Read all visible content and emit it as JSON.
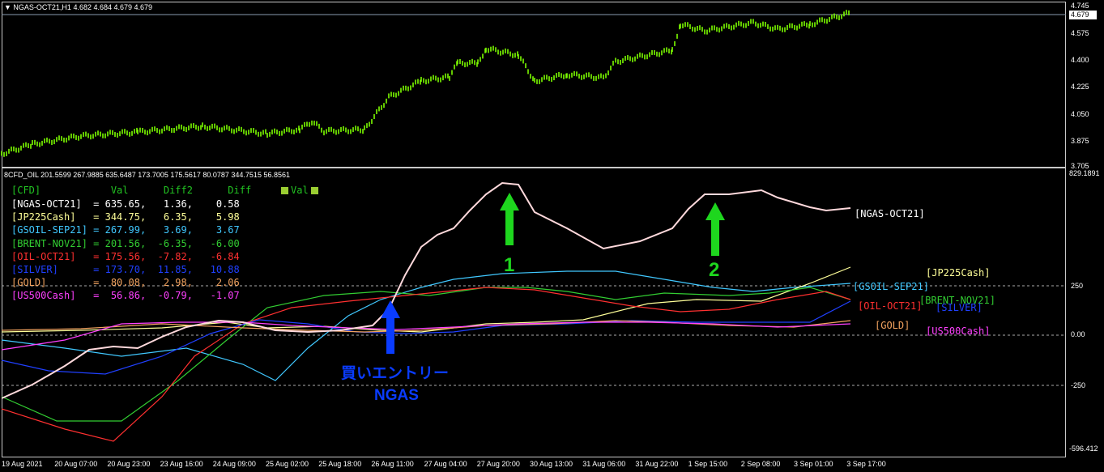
{
  "chart_title": "NGAS-OCT21,H1  4.682 4.684 4.679 4.679",
  "indicator_title": "8CFD_OIL 201.5599 267.9885 635.6487 173.7005 175.5617 80.0787 344.7515 56.8561",
  "current_price_tag": "4.679",
  "price_axis": [
    "4.745",
    "4.575",
    "4.400",
    "4.225",
    "4.050",
    "3.875",
    "3.705"
  ],
  "indicator_axis": [
    "829.1891",
    "250",
    "0.00",
    "-250",
    "-596.412"
  ],
  "time_axis": [
    "19 Aug 2021",
    "20 Aug 07:00",
    "20 Aug 23:00",
    "23 Aug 16:00",
    "24 Aug 09:00",
    "25 Aug 02:00",
    "25 Aug 18:00",
    "26 Aug 11:00",
    "27 Aug 04:00",
    "27 Aug 20:00",
    "30 Aug 13:00",
    "31 Aug 06:00",
    "31 Aug 22:00",
    "1 Sep 15:00",
    "2 Sep 08:00",
    "3 Sep 01:00",
    "3 Sep 17:00"
  ],
  "table": {
    "header": "[CFD]            Val      Diff2      Diff",
    "legend_label": "Val",
    "rows": [
      {
        "text": "[NGAS-OCT21]  = 635.65,   1.36,    0.58",
        "color": "#ffffff"
      },
      {
        "text": "[JP225Cash]   = 344.75,   6.35,    5.98",
        "color": "#ffff99"
      },
      {
        "text": "[GSOIL-SEP21] = 267.99,   3.69,    3.67",
        "color": "#40c8ff"
      },
      {
        "text": "[BRENT-NOV21] = 201.56,  -6.35,   -6.00",
        "color": "#32cd32"
      },
      {
        "text": "[OIL-OCT21]   = 175.56,  -7.82,   -6.84",
        "color": "#ff3030"
      },
      {
        "text": "[SILVER]      = 173.70,  11.85,   10.88",
        "color": "#2040ff"
      },
      {
        "text": "[GOLD]        =  80.08,   2.98,    2.06",
        "color": "#f4a460"
      },
      {
        "text": "[US500Cash]   =  56.86,  -0.79,   -1.07",
        "color": "#ff40ff"
      }
    ]
  },
  "series_labels": [
    {
      "text": "[NGAS-OCT21]",
      "color": "#ffffff"
    },
    {
      "text": "[JP225Cash]",
      "color": "#ffff99"
    },
    {
      "text": "[GSOIL-SEP21]",
      "color": "#40c8ff"
    },
    {
      "text": "[BRENT-NOV21]",
      "color": "#32cd32"
    },
    {
      "text": "[OIL-OCT21]",
      "color": "#ff3030"
    },
    {
      "text": "[SILVER]",
      "color": "#2040ff"
    },
    {
      "text": "[GOLD]",
      "color": "#f4a460"
    },
    {
      "text": "[US500Cash]",
      "color": "#ff40ff"
    }
  ],
  "annotations": {
    "entry_line1": "買いエントリー",
    "entry_line2": "NGAS",
    "marker1": "1",
    "marker2": "2"
  },
  "colors": {
    "candle": "#7cfc00",
    "entry_arrow": "#0a3cff",
    "marker_arrow": "#1ed61e"
  }
}
